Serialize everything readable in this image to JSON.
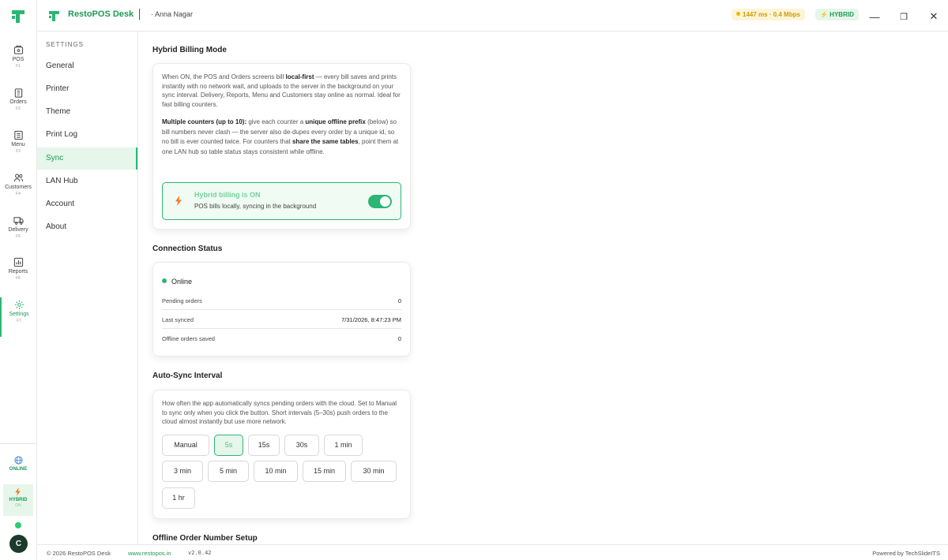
{
  "titlebar": {
    "app_name": "RestoPOS Desk",
    "branch": "· Anna Nagar",
    "ping": "1447 ms · 0.4 Mbps",
    "mode_badge": "⚡ HYBRID",
    "minimize": "—",
    "restore": "❐",
    "close": "✕"
  },
  "rail": {
    "items": [
      {
        "label": "POS",
        "key": "F1",
        "icon": "cash-register-icon"
      },
      {
        "label": "Orders",
        "key": "F2",
        "icon": "clipboard-icon"
      },
      {
        "label": "Menu",
        "key": "F3",
        "icon": "menu-book-icon"
      },
      {
        "label": "Customers",
        "key": "F4",
        "icon": "users-icon"
      },
      {
        "label": "Delivery",
        "key": "F5",
        "icon": "truck-icon"
      },
      {
        "label": "Reports",
        "key": "F6",
        "icon": "bar-chart-icon"
      },
      {
        "label": "Settings",
        "key": "F7",
        "icon": "gear-icon"
      }
    ],
    "online": "ONLINE",
    "hybrid": "HYBRID",
    "hybrid_state": "ON",
    "avatar": "C"
  },
  "settings_nav": {
    "heading": "SETTINGS",
    "items": [
      "General",
      "Printer",
      "Theme",
      "Print Log",
      "Sync",
      "LAN Hub",
      "Account",
      "About"
    ],
    "active": "Sync"
  },
  "hybrid": {
    "title": "Hybrid Billing Mode",
    "p1_a": "When ON, the POS and Orders screens bill ",
    "p1_b": "local-first",
    "p1_c": " — every bill saves and prints instantly with no network wait, and uploads to the server in the background on your sync interval. Delivery, Reports, Menu and Customers stay online as normal. Ideal for fast billing counters.",
    "p2_a": "Multiple counters (up to 10):",
    "p2_b": " give each counter a ",
    "p2_c": "unique offline prefix",
    "p2_d": " (below) so bill numbers never clash — the server also de-dupes every order by a unique id, so no bill is ever counted twice. For counters that ",
    "p2_e": "share the same tables",
    "p2_f": ", point them at one LAN hub so table status stays consistent while offline.",
    "box_title": "Hybrid billing is ON",
    "box_sub": "POS bills locally, syncing in the background",
    "enabled": true
  },
  "connection": {
    "title": "Connection Status",
    "status": "Online",
    "rows": [
      {
        "label": "Pending orders",
        "value": "0"
      },
      {
        "label": "Last synced",
        "value": "7/31/2026, 8:47:23 PM"
      },
      {
        "label": "Offline orders saved",
        "value": "0"
      }
    ]
  },
  "autosync": {
    "title": "Auto-Sync Interval",
    "desc": "How often the app automatically syncs pending orders with the cloud. Set to Manual to sync only when you click the button. Short intervals (5–30s) push orders to the cloud almost instantly but use more network.",
    "options": [
      "Manual",
      "5s",
      "15s",
      "30s",
      "1 min",
      "3 min",
      "5 min",
      "10 min",
      "15 min",
      "30 min",
      "1 hr"
    ],
    "selected": "5s"
  },
  "offline_setup": {
    "title": "Offline Order Number Setup"
  },
  "footer": {
    "copyright": "© 2026 RestoPOS Desk",
    "link": "www.restopos.in",
    "version": "v2.0.42",
    "powered": "Powered by TechSlideITS"
  },
  "colors": {
    "accent": "#2bb673",
    "accent_dark": "#1f9a55",
    "accent_bg": "#e6f6ea"
  }
}
